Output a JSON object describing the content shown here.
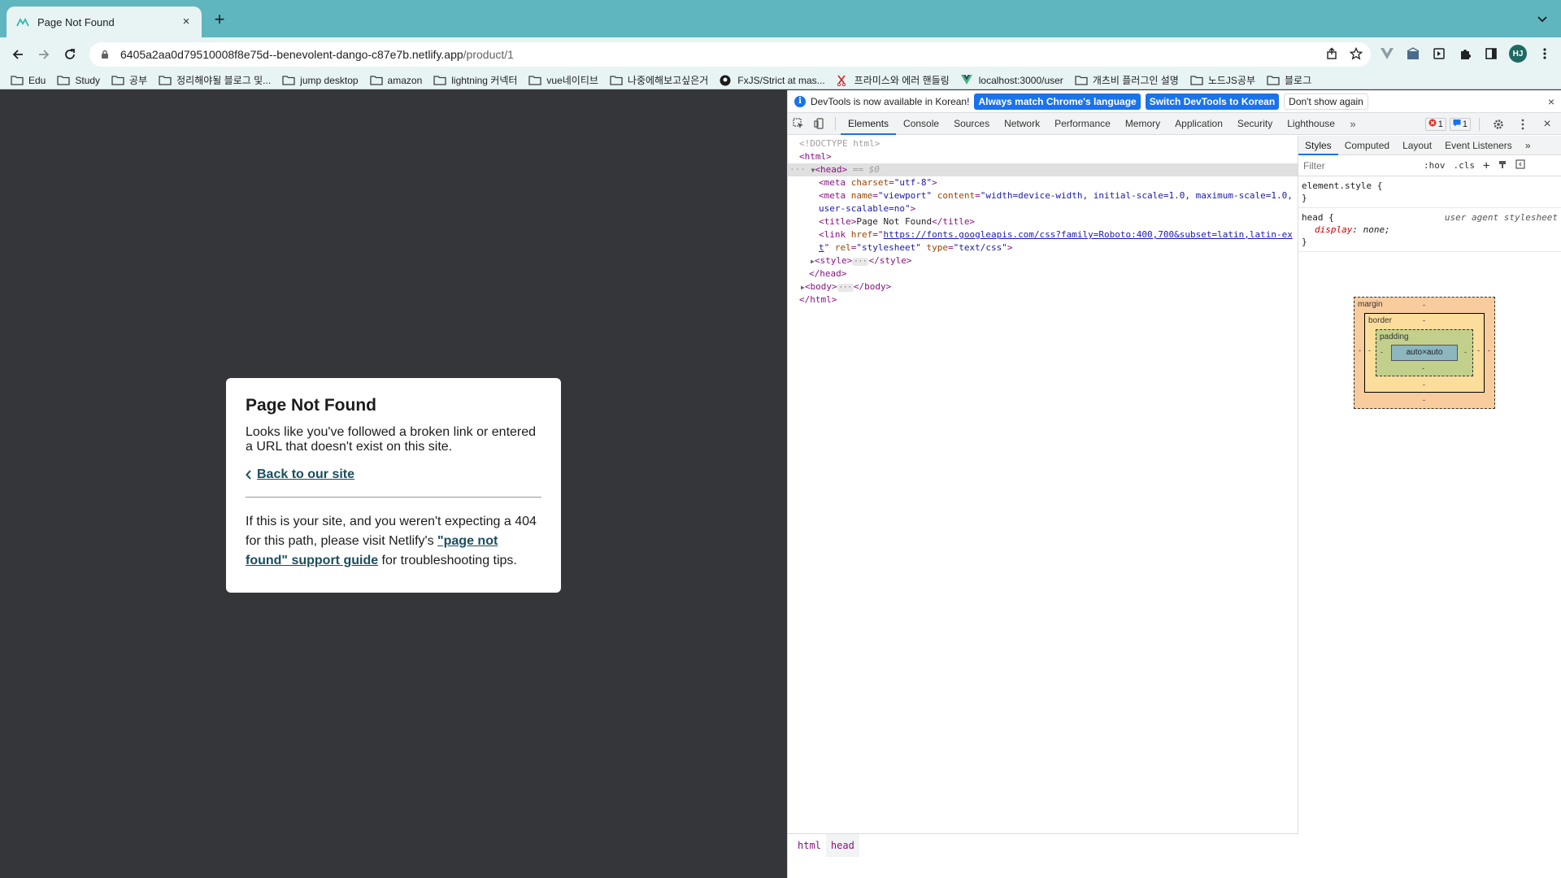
{
  "browser": {
    "tab_title": "Page Not Found",
    "url_host": "6405a2aa0d79510008f8e75d--benevolent-dango-c87e7b.netlify.app",
    "url_path": "/product/1",
    "avatar_initials": "HJ",
    "bookmarks": [
      {
        "label": "Edu",
        "icon": "folder-icon"
      },
      {
        "label": "Study",
        "icon": "folder-icon"
      },
      {
        "label": "공부",
        "icon": "folder-icon"
      },
      {
        "label": "정리해야될 블로그 및...",
        "icon": "folder-icon"
      },
      {
        "label": "jump desktop",
        "icon": "folder-icon"
      },
      {
        "label": "amazon",
        "icon": "folder-icon"
      },
      {
        "label": "lightning 커넥터",
        "icon": "folder-icon"
      },
      {
        "label": "vue네이티브",
        "icon": "folder-icon"
      },
      {
        "label": "나중에해보고싶은거",
        "icon": "folder-icon"
      },
      {
        "label": "FxJS/Strict at mas...",
        "icon": "github-icon"
      },
      {
        "label": "프라미스와 에러 핸들링",
        "icon": "scissors-icon"
      },
      {
        "label": "localhost:3000/user",
        "icon": "vue-icon"
      },
      {
        "label": "개츠비 플러그인 설명",
        "icon": "folder-icon"
      },
      {
        "label": "노드JS공부",
        "icon": "folder-icon"
      },
      {
        "label": "블로그",
        "icon": "folder-icon"
      }
    ]
  },
  "page": {
    "heading": "Page Not Found",
    "intro": "Looks like you've followed a broken link or entered a URL that doesn't exist on this site.",
    "back_link": "Back to our site",
    "help_before": "If this is your site, and you weren't expecting a 404 for this path, please visit Netlify's ",
    "help_link": "\"page not found\" support guide",
    "help_after": " for troubleshooting tips."
  },
  "devtools": {
    "infobar": {
      "message": "DevTools is now available in Korean!",
      "btn_match": "Always match Chrome's language",
      "btn_switch": "Switch DevTools to Korean",
      "btn_dismiss": "Don't show again"
    },
    "tabs": [
      "Elements",
      "Console",
      "Sources",
      "Network",
      "Performance",
      "Memory",
      "Application",
      "Security",
      "Lighthouse"
    ],
    "error_count": "1",
    "message_count": "1",
    "dom": {
      "doctype": "<!DOCTYPE html>",
      "html_open": "<html>",
      "head_open": "<head>",
      "head_marker": " == $0",
      "meta_charset_attr": "charset",
      "meta_charset_val": "\"utf-8\"",
      "meta_viewport_name_val": "\"viewport\"",
      "meta_viewport_content_val": "\"width=device-width, initial-scale=1.0, maximum-scale=1.0,",
      "meta_viewport_content_cont": "user-scalable=no\"",
      "title_text": "Page Not Found",
      "link_href": "https://fonts.googleapis.com/css?family=Roboto:400,700&subset=latin,latin-ex",
      "link_href_cont": "t",
      "link_rel_val": "\"stylesheet\"",
      "link_type_val": "\"text/css\"",
      "head_close": "</head>",
      "html_close": "</html>"
    },
    "breadcrumbs": [
      "html",
      "head"
    ],
    "styles": {
      "tabs": [
        "Styles",
        "Computed",
        "Layout",
        "Event Listeners"
      ],
      "filter_placeholder": "Filter",
      "hov": ":hov",
      "cls": ".cls",
      "element_style": "element.style {",
      "close_brace": "}",
      "rule_selector": "head {",
      "rule_origin": "user agent stylesheet",
      "rule_prop": "display",
      "rule_val": "none;",
      "box": {
        "margin_label": "margin",
        "border_label": "border",
        "padding_label": "padding",
        "content": "auto×auto",
        "dash": "-"
      }
    }
  },
  "colors": {
    "tabstrip": "#5fb6bf",
    "toolbar": "#e8f3f4",
    "page_bg": "#35363a",
    "link": "#1b4d5e",
    "accent": "#1a73e8"
  }
}
